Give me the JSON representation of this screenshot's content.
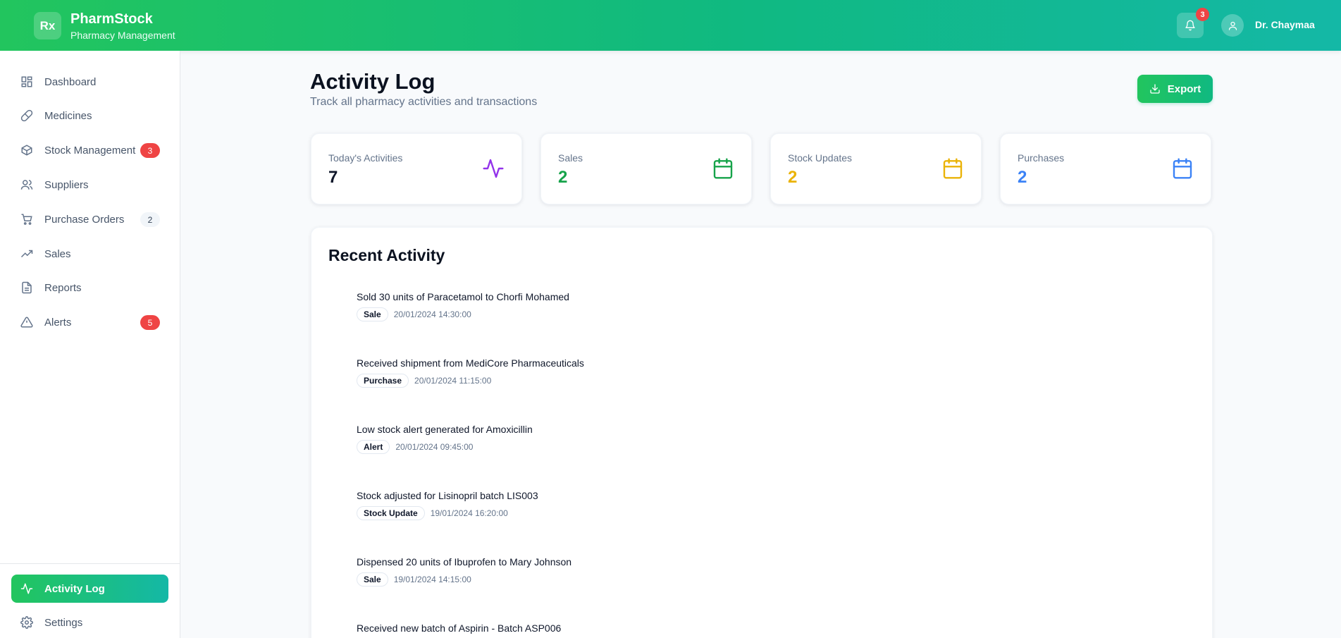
{
  "header": {
    "logo_text": "Rx",
    "app_name": "PharmStock",
    "app_subtitle": "Pharmacy Management",
    "notification_count": "3",
    "user_name": "Dr. Chaymaa"
  },
  "sidebar": {
    "items": [
      {
        "label": "Dashboard",
        "icon": "dashboard-icon",
        "badge": ""
      },
      {
        "label": "Medicines",
        "icon": "pill-icon",
        "badge": ""
      },
      {
        "label": "Stock Management",
        "icon": "package-icon",
        "badge": "3"
      },
      {
        "label": "Suppliers",
        "icon": "users-icon",
        "badge": ""
      },
      {
        "label": "Purchase Orders",
        "icon": "cart-icon",
        "badge": "2"
      },
      {
        "label": "Sales",
        "icon": "trending-up-icon",
        "badge": ""
      },
      {
        "label": "Reports",
        "icon": "file-icon",
        "badge": ""
      },
      {
        "label": "Alerts",
        "icon": "alert-triangle-icon",
        "badge": "5"
      }
    ],
    "bottom_items": [
      {
        "label": "Activity Log",
        "icon": "activity-icon"
      },
      {
        "label": "Settings",
        "icon": "gear-icon"
      }
    ]
  },
  "page": {
    "title": "Activity Log",
    "subtitle": "Track all pharmacy activities and transactions",
    "export_label": "Export"
  },
  "stats": [
    {
      "label": "Today's Activities",
      "value": "7",
      "color": "#0f172a",
      "icon": "activity-icon",
      "icon_color": "#9333ea"
    },
    {
      "label": "Sales",
      "value": "2",
      "color": "#16a34a",
      "icon": "calendar-icon",
      "icon_color": "#16a34a"
    },
    {
      "label": "Stock Updates",
      "value": "2",
      "color": "#eab308",
      "icon": "calendar-icon",
      "icon_color": "#eab308"
    },
    {
      "label": "Purchases",
      "value": "2",
      "color": "#3b82f6",
      "icon": "calendar-icon",
      "icon_color": "#3b82f6"
    }
  ],
  "recent": {
    "title": "Recent Activity",
    "items": [
      {
        "description": "Sold 30 units of Paracetamol to Chorfi Mohamed",
        "type": "Sale",
        "timestamp": "20/01/2024 14:30:00"
      },
      {
        "description": "Received shipment from MediCore Pharmaceuticals",
        "type": "Purchase",
        "timestamp": "20/01/2024 11:15:00"
      },
      {
        "description": "Low stock alert generated for Amoxicillin",
        "type": "Alert",
        "timestamp": "20/01/2024 09:45:00"
      },
      {
        "description": "Stock adjusted for Lisinopril batch LIS003",
        "type": "Stock Update",
        "timestamp": "19/01/2024 16:20:00"
      },
      {
        "description": "Dispensed 20 units of Ibuprofen to Mary Johnson",
        "type": "Sale",
        "timestamp": "19/01/2024 14:15:00"
      },
      {
        "description": "Received new batch of Aspirin - Batch ASP006",
        "type": "",
        "timestamp": ""
      }
    ]
  }
}
